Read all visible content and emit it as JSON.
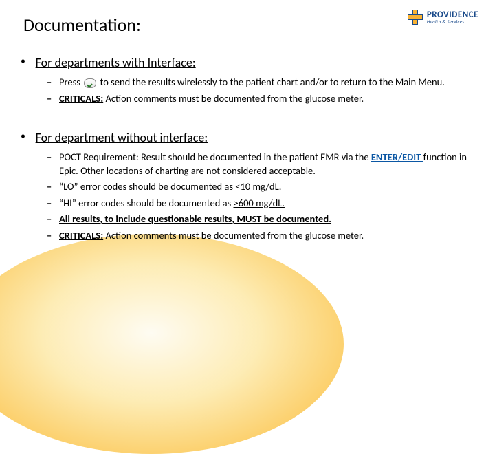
{
  "title": "Documentation:",
  "logo": {
    "brand": "PROVIDENCE",
    "tagline": "Health & Services"
  },
  "sections": [
    {
      "heading": "For departments with Interface:",
      "items": [
        {
          "pre": "Press ",
          "post": "to send the results wirelessly to the patient chart and/or to return to the Main Menu.",
          "hasIcon": true
        },
        {
          "label": "CRITICALS:",
          "text": "  Action comments must be documented from the glucose meter."
        }
      ]
    },
    {
      "heading": "For department without interface:",
      "items": [
        {
          "pre": "POCT Requirement:  Result should be documented in the patient EMR via the ",
          "link": "ENTER/EDIT ",
          "post2": "function in Epic.  Other locations of charting are not considered acceptable."
        },
        {
          "pre": "“LO” error codes should be documented as ",
          "u": "<10 mg/dL."
        },
        {
          "pre": "“HI” error codes should be documented as ",
          "u": ">600 mg/dL."
        },
        {
          "allUB": "All results, to include questionable results, MUST be documented."
        },
        {
          "label": "CRITICALS:",
          "text": " Action comments must be documented from the glucose meter."
        }
      ]
    }
  ]
}
